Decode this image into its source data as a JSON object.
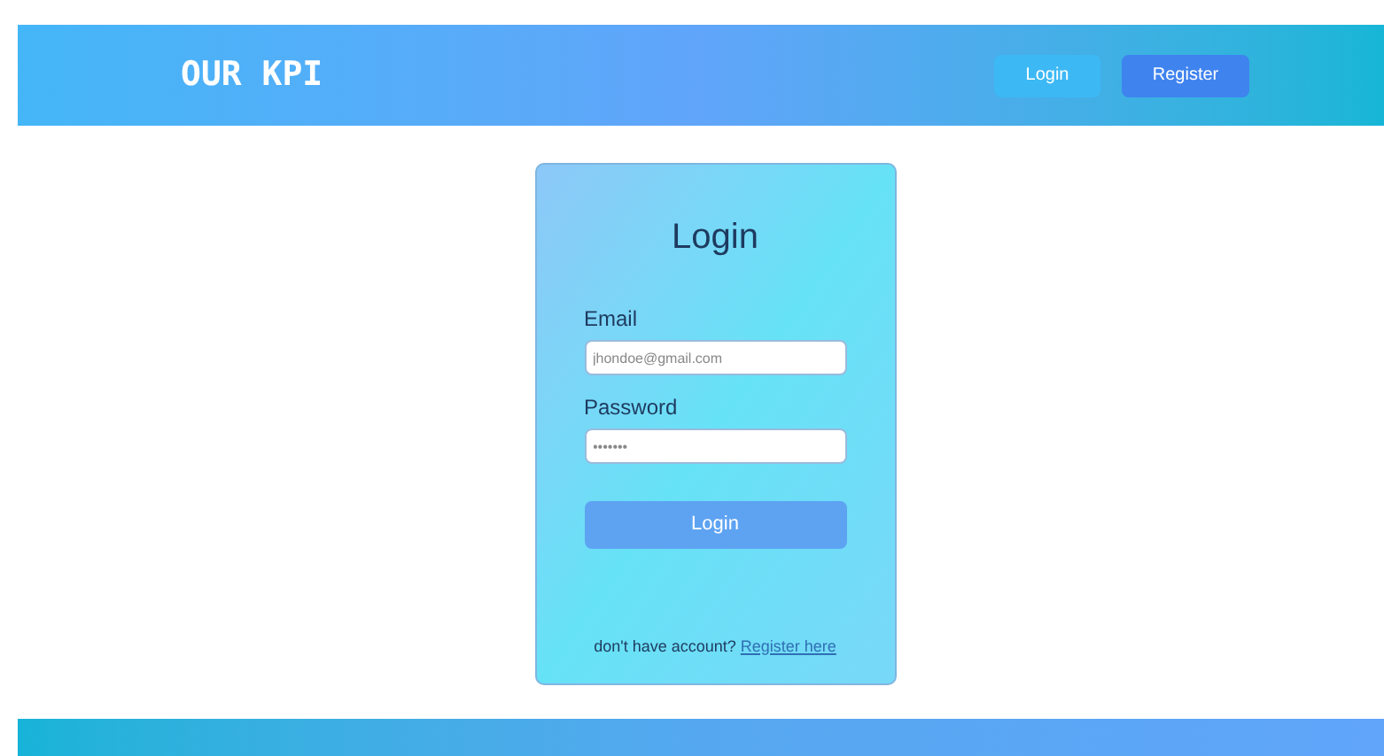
{
  "header": {
    "logo": "OUR KPI",
    "buttons": [
      {
        "label": "Login",
        "kind": "secondary"
      },
      {
        "label": "Register",
        "kind": "primary"
      }
    ]
  },
  "login_card": {
    "title": "Login",
    "fields": [
      {
        "label": "Email",
        "placeholder": "jhondoe@gmail.com"
      },
      {
        "label": "Password",
        "placeholder": "•••••••"
      }
    ],
    "submit": "Login",
    "prompt": "don't have account?",
    "link": "Register here"
  }
}
